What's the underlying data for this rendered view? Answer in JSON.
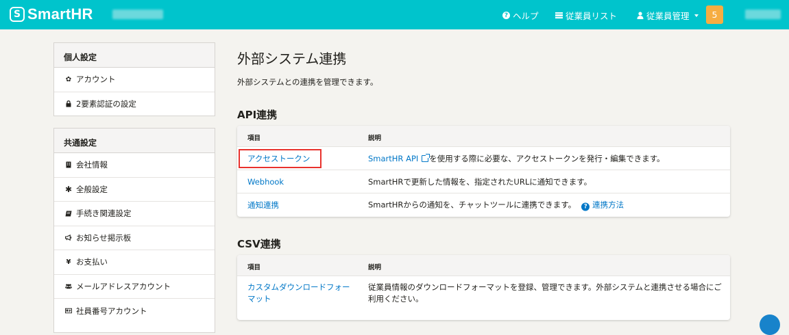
{
  "header": {
    "brand": "SmartHR",
    "brand_mark": "S",
    "nav": {
      "help": "ヘルプ",
      "employee_list": "従業員リスト",
      "employee_manage": "従業員管理"
    },
    "notification_count": "5",
    "colors": {
      "bar": "#00c4cc",
      "badge": "#f6ad42"
    }
  },
  "sidebar": {
    "personal": {
      "title": "個人設定",
      "items": [
        {
          "label": "アカウント",
          "icon": "gear-icon"
        },
        {
          "label": "2要素認証の設定",
          "icon": "lock-icon"
        }
      ]
    },
    "common": {
      "title": "共通設定",
      "items": [
        {
          "label": "会社情報",
          "icon": "building-icon"
        },
        {
          "label": "全般設定",
          "icon": "asterisk-icon"
        },
        {
          "label": "手続き関連設定",
          "icon": "book-icon"
        },
        {
          "label": "お知らせ掲示板",
          "icon": "megaphone-icon"
        },
        {
          "label": "お支払い",
          "icon": "yen-icon"
        },
        {
          "label": "メールアドレスアカウント",
          "icon": "users-icon"
        },
        {
          "label": "社員番号アカウント",
          "icon": "id-card-icon"
        }
      ]
    }
  },
  "main": {
    "title": "外部システム連携",
    "description": "外部システムとの連携を管理できます。",
    "api": {
      "title": "API連携",
      "col_item": "項目",
      "col_desc": "説明",
      "rows": [
        {
          "item": "アクセストークン",
          "desc_link": "SmartHR API",
          "desc": "を使用する際に必要な、アクセストークンを発行・編集できます。"
        },
        {
          "item": "Webhook",
          "desc": "SmartHRで更新した情報を、指定されたURLに通知できます。"
        },
        {
          "item": "通知連携",
          "desc": "SmartHRからの通知を、チャットツールに連携できます。",
          "help_link": "連携方法"
        }
      ]
    },
    "csv": {
      "title": "CSV連携",
      "col_item": "項目",
      "col_desc": "説明",
      "rows": [
        {
          "item": "カスタムダウンロードフォーマット",
          "desc": "従業員情報のダウンロードフォーマットを登録、管理できます。外部システムと連携させる場合にご利用ください。"
        }
      ]
    },
    "colors": {
      "link": "#0077c7",
      "highlight": "#e8312c"
    }
  }
}
